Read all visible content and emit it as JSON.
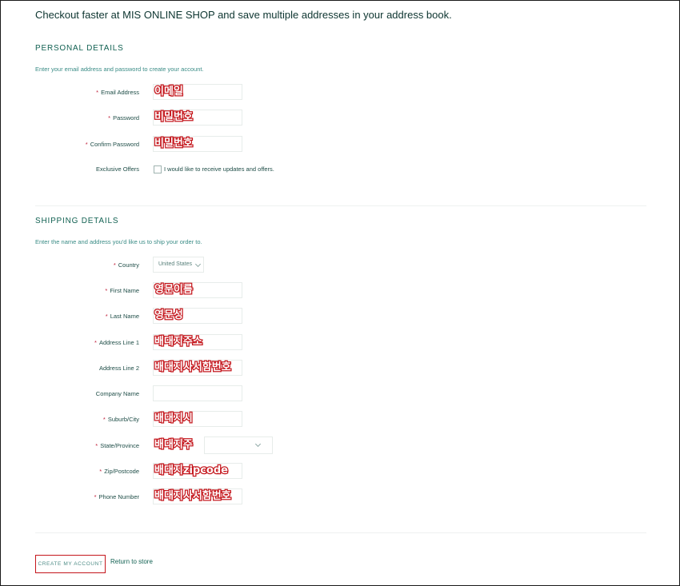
{
  "headline": "Checkout faster at MIS ONLINE SHOP and save multiple addresses in your address book.",
  "personal": {
    "title": "PERSONAL DETAILS",
    "description": "Enter your email address and password to create your account.",
    "email_label": "Email Address",
    "email_value": "이메일",
    "password_label": "Password",
    "password_value": "비밀번호",
    "confirm_label": "Confirm Password",
    "confirm_value": "비밀번호",
    "offers_label": "Exclusive Offers",
    "offers_checkbox_label": "I would like to receive updates and offers."
  },
  "shipping": {
    "title": "SHIPPING DETAILS",
    "description": "Enter the name and address you'd like us to ship your order to.",
    "country_label": "Country",
    "country_value": "United States",
    "first_name_label": "First Name",
    "first_name_value": "영문이름",
    "last_name_label": "Last Name",
    "last_name_value": "영문성",
    "address1_label": "Address Line 1",
    "address1_value": "배대지주소",
    "address2_label": "Address Line 2",
    "address2_value": "배대지사서함번호",
    "company_label": "Company Name",
    "suburb_label": "Suburb/City",
    "suburb_value": "배대지시",
    "state_label": "State/Province",
    "state_value": "배대지주",
    "zip_label": "Zip/Postcode",
    "zip_value": "배대지zipcode",
    "phone_label": "Phone Number",
    "phone_value": "배대지사서함번호"
  },
  "actions": {
    "create_label": "CREATE MY ACCOUNT",
    "return_label": "Return to store"
  },
  "colors": {
    "annotation_red": "#c4161c",
    "accent_teal": "#136253"
  }
}
